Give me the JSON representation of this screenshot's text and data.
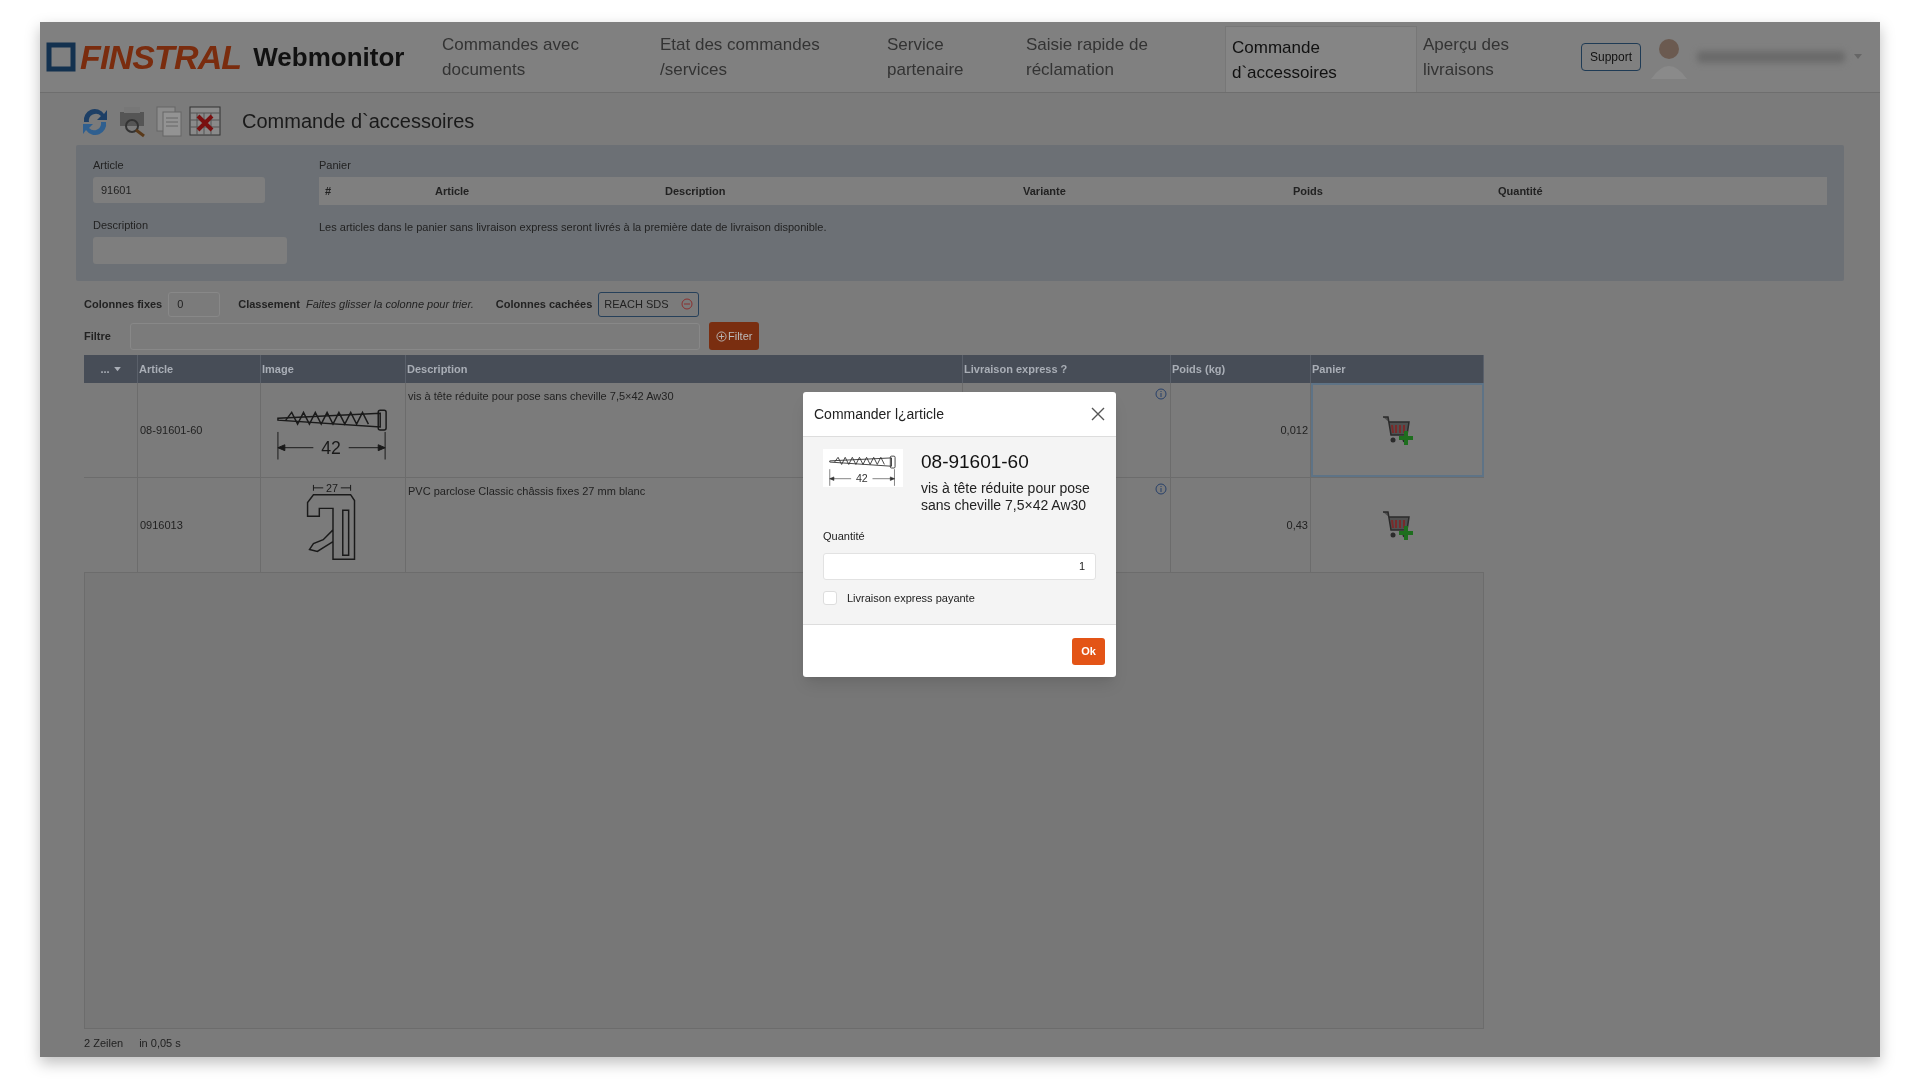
{
  "header": {
    "logo_text": "FINSTRAL",
    "app_name": "Webmonitor",
    "nav": [
      {
        "label": "Commandes avec documents",
        "selected": false
      },
      {
        "label": "Etat des commandes /services",
        "selected": false
      },
      {
        "label": "Service partenaire",
        "selected": false
      },
      {
        "label": "Saisie rapide de réclamation",
        "selected": false
      },
      {
        "label": "Commande d`accessoires",
        "selected": true
      },
      {
        "label": "Aperçu des livraisons",
        "selected": false
      }
    ],
    "support_button": "Support"
  },
  "toolbar": {
    "title": "Commande d`accessoires"
  },
  "search_panel": {
    "article_label": "Article",
    "article_value": "91601",
    "description_label": "Description",
    "cart_label": "Panier",
    "cart_columns": [
      "#",
      "Article",
      "Description",
      "Variante",
      "Poids",
      "Quantité"
    ],
    "cart_note": "Les articles dans le panier sans livraison express seront livrés à la première date de livraison disponible."
  },
  "grid_options": {
    "fixed_label": "Colonnes fixes",
    "fixed_value": "0",
    "sort_label": "Classement",
    "sort_hint": "Faites glisser la colonne pour trier.",
    "hidden_label": "Colonnes cachées",
    "hidden_tags": [
      "REACH SDS"
    ],
    "filter_label": "Filtre",
    "filter_button": "Filter"
  },
  "table": {
    "columns": [
      "...",
      "Article",
      "Image",
      "Description",
      "Livraison express ?",
      "Poids (kg)",
      "Panier"
    ],
    "rows": [
      {
        "article": "08-91601-60",
        "image": {
          "kind": "screw",
          "dimension": "42"
        },
        "description": "vis à tête réduite pour pose sans cheville 7,5×42 Aw30",
        "weight": "0,012",
        "selected": true
      },
      {
        "article": "0916013",
        "image": {
          "kind": "profile",
          "dimension": "27"
        },
        "description": "PVC parclose Classic châssis fixes 27 mm blanc",
        "weight": "0,43",
        "selected": false
      }
    ]
  },
  "status_bar": {
    "rows": "2 Zeilen",
    "time": "in 0,05 s"
  },
  "dialog": {
    "title": "Commander l¿article",
    "image": {
      "kind": "screw",
      "dimension": "42"
    },
    "article": "08-91601-60",
    "description": "vis à tête réduite pour pose sans cheville 7,5×42 Aw30",
    "quantity_label": "Quantité",
    "quantity_value": "1",
    "express": {
      "label": "Livraison express payante",
      "checked": false
    },
    "ok_button": "Ok"
  }
}
